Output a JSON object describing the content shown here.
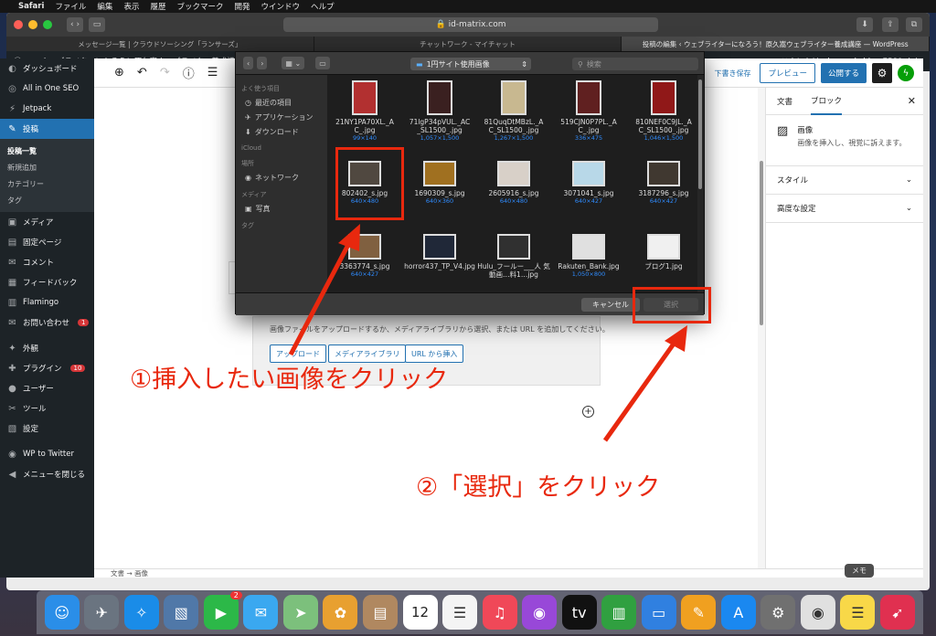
{
  "menubar": {
    "app": "Safari",
    "items": [
      "ファイル",
      "編集",
      "表示",
      "履歴",
      "ブックマーク",
      "開発",
      "ウインドウ",
      "ヘルプ"
    ]
  },
  "safari": {
    "address": "id-matrix.com",
    "tabs": [
      "メッセージ一覧 | クラウドソーシング「ランサーズ」",
      "チャットワーク - マイチャット",
      "投稿の編集 ‹ ウェブライターになろう！原久嵩ウェブライター養成講座 — WordPress"
    ]
  },
  "adminbar": {
    "site": "ウェブライターになろう！原久嵩ウェブライター養成講座",
    "greeting": "こんにちは、kuronekohime7580 さん"
  },
  "sidebar": {
    "items": [
      {
        "icon": "dashboard-icon",
        "glyph": "◐",
        "label": "ダッシュボード"
      },
      {
        "icon": "seo-icon",
        "glyph": "◎",
        "label": "All in One SEO"
      },
      {
        "icon": "jetpack-icon",
        "glyph": "⚡",
        "label": "Jetpack"
      },
      {
        "icon": "pin-icon",
        "glyph": "✎",
        "label": "投稿"
      },
      {
        "icon": "media-icon",
        "glyph": "▣",
        "label": "メディア"
      },
      {
        "icon": "page-icon",
        "glyph": "▤",
        "label": "固定ページ"
      },
      {
        "icon": "comment-icon",
        "glyph": "✉",
        "label": "コメント"
      },
      {
        "icon": "feedback-icon",
        "glyph": "▦",
        "label": "フィードバック"
      },
      {
        "icon": "flamingo-icon",
        "glyph": "▥",
        "label": "Flamingo"
      },
      {
        "icon": "mail-icon",
        "glyph": "✉",
        "label": "お問い合わせ",
        "badge": "1"
      },
      {
        "icon": "appearance-icon",
        "glyph": "✦",
        "label": "外観"
      },
      {
        "icon": "plugin-icon",
        "glyph": "✚",
        "label": "プラグイン",
        "badge": "10"
      },
      {
        "icon": "user-icon",
        "glyph": "●",
        "label": "ユーザー"
      },
      {
        "icon": "tool-icon",
        "glyph": "✂",
        "label": "ツール"
      },
      {
        "icon": "settings-icon",
        "glyph": "▧",
        "label": "設定"
      },
      {
        "icon": "wp-to-twitter-icon",
        "glyph": "◉",
        "label": "WP to Twitter"
      },
      {
        "icon": "collapse-icon",
        "glyph": "◀",
        "label": "メニューを閉じる"
      }
    ],
    "sub": [
      "投稿一覧",
      "新規追加",
      "カテゴリー",
      "タグ"
    ]
  },
  "editor": {
    "draft": "下書き保存",
    "preview": "プレビュー",
    "publish": "公開する",
    "block_hint": "画像ファイルをアップロードするか、メディアライブラリから選択、または URL を追加してください。",
    "upload": "アップロード",
    "media_library": "メディアライブラリ",
    "insert_url": "URL から挿入",
    "breadcrumb": [
      "文書",
      "画像"
    ]
  },
  "settings": {
    "tab_doc": "文書",
    "tab_block": "ブロック",
    "block_title": "画像",
    "block_desc": "画像を挿入し、視覚に訴えます。",
    "panels": [
      "スタイル",
      "高度な設定"
    ]
  },
  "dialog": {
    "location": "1円サイト使用画像",
    "search_placeholder": "検索",
    "sections": [
      {
        "heading": "よく使う項目",
        "items": [
          [
            "clock-icon",
            "◷",
            "最近の項目"
          ],
          [
            "apps-icon",
            "✈",
            "アプリケーション"
          ],
          [
            "download-icon",
            "⬇",
            "ダウンロード"
          ]
        ]
      },
      {
        "heading": "iCloud",
        "items": []
      },
      {
        "heading": "場所",
        "items": [
          [
            "network-icon",
            "◉",
            "ネットワーク"
          ]
        ]
      },
      {
        "heading": "メディア",
        "items": [
          [
            "photo-icon",
            "▣",
            "写真"
          ]
        ]
      },
      {
        "heading": "タグ",
        "items": []
      }
    ],
    "files": [
      {
        "name": "21NY1PA70XL._A C_.jpg",
        "size": "99×140",
        "color": "#b23030"
      },
      {
        "name": "71lgP34pVUL._AC _SL1500_.jpg",
        "size": "1,057×1,500",
        "color": "#3a2020"
      },
      {
        "name": "81QuqDtMBzL._A C_SL1500_.jpg",
        "size": "1,267×1,500",
        "color": "#c8b890"
      },
      {
        "name": "519CJN0P7PL._A C_.jpg",
        "size": "336×475",
        "color": "#602020"
      },
      {
        "name": "810NEF0C9JL._A C_SL1500_.jpg",
        "size": "1,046×1,500",
        "color": "#901818"
      },
      {
        "name": "802402_s.jpg",
        "size": "640×480",
        "color": "#504840"
      },
      {
        "name": "1690309_s.jpg",
        "size": "640×360",
        "color": "#a07020"
      },
      {
        "name": "2605916_s.jpg",
        "size": "640×480",
        "color": "#d8d0c8"
      },
      {
        "name": "3071041_s.jpg",
        "size": "640×427",
        "color": "#b8d8e8"
      },
      {
        "name": "3187296_s.jpg",
        "size": "640×427",
        "color": "#403830"
      },
      {
        "name": "3363774_s.jpg",
        "size": "640×427",
        "color": "#806040"
      },
      {
        "name": "horror437_TP_V4.jpg",
        "size": "",
        "color": "#202838"
      },
      {
        "name": "Hulu_フールー___人 気動画…料1…jpg",
        "size": "",
        "color": "#303030"
      },
      {
        "name": "Rakuten_Bank.jpg",
        "size": "1,050×800",
        "color": "#e0e0e0"
      },
      {
        "name": "ブログ1.jpg",
        "size": "",
        "color": "#f0f0f0"
      }
    ],
    "cancel": "キャンセル",
    "select": "選択"
  },
  "annotations": {
    "step1": "①挿入したい画像をクリック",
    "step2": "②「選択」をクリック",
    "color": "#e8280e"
  },
  "dock": {
    "tooltip": "メモ",
    "calendar_day": "12",
    "mail_badge": "2",
    "items": [
      {
        "name": "finder-icon",
        "color": "#2a8ee8",
        "glyph": "☺"
      },
      {
        "name": "launchpad-icon",
        "color": "#6a7480",
        "glyph": "✈"
      },
      {
        "name": "safari-icon",
        "color": "#1a8ce8",
        "glyph": "✧"
      },
      {
        "name": "preview-icon",
        "color": "#5078a8",
        "glyph": "▧"
      },
      {
        "name": "facetime-icon",
        "color": "#2cb848",
        "glyph": "▶"
      },
      {
        "name": "messages-icon",
        "color": "#3aa8f0",
        "glyph": "✉"
      },
      {
        "name": "maps-icon",
        "color": "#7cc07c",
        "glyph": "➤"
      },
      {
        "name": "photos-icon",
        "color": "#e8a030",
        "glyph": "✿"
      },
      {
        "name": "contacts-icon",
        "color": "#b08860",
        "glyph": "▤"
      },
      {
        "name": "calendar-icon",
        "color": "#ffffff",
        "glyph": "12"
      },
      {
        "name": "reminders-icon",
        "color": "#f4f4f4",
        "glyph": "☰"
      },
      {
        "name": "music-icon",
        "color": "#f04858",
        "glyph": "♫"
      },
      {
        "name": "podcasts-icon",
        "color": "#9848d8",
        "glyph": "◉"
      },
      {
        "name": "tv-icon",
        "color": "#111111",
        "glyph": "tv"
      },
      {
        "name": "numbers-icon",
        "color": "#30a040",
        "glyph": "▥"
      },
      {
        "name": "keynote-icon",
        "color": "#3080e0",
        "glyph": "▭"
      },
      {
        "name": "pages-icon",
        "color": "#f0a020",
        "glyph": "✎"
      },
      {
        "name": "app-store-icon",
        "color": "#1a88f0",
        "glyph": "A"
      },
      {
        "name": "system-preferences-icon",
        "color": "#707070",
        "glyph": "⚙"
      },
      {
        "name": "chrome-icon",
        "color": "#e0e0e0",
        "glyph": "◉"
      },
      {
        "name": "notes-icon",
        "color": "#f8d848",
        "glyph": "☰"
      },
      {
        "name": "skitch-icon",
        "color": "#e03050",
        "glyph": "➹"
      }
    ]
  }
}
